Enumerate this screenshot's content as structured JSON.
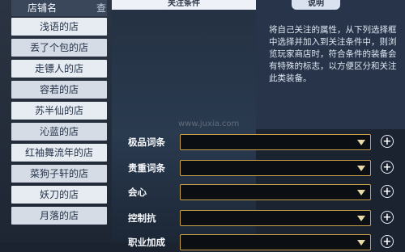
{
  "shop_list": {
    "header": {
      "name_col": "店铺名",
      "second_col": "查"
    },
    "items": [
      {
        "label": "浅语的店"
      },
      {
        "label": "丢了个包的店"
      },
      {
        "label": "走镖人的店"
      },
      {
        "label": "容若的店"
      },
      {
        "label": "苏半仙的店"
      },
      {
        "label": "沁蓝的店"
      },
      {
        "label": "红袖舞流年的店"
      },
      {
        "label": "菜狗子轩的店"
      },
      {
        "label": "妖刀的店"
      },
      {
        "label": "月落的店"
      }
    ]
  },
  "filter_panel": {
    "title": "关注条件",
    "rows": [
      {
        "label": "极品词条",
        "value": ""
      },
      {
        "label": "贵重词条",
        "value": ""
      },
      {
        "label": "会心",
        "value": ""
      },
      {
        "label": "控制抗",
        "value": ""
      },
      {
        "label": "职业加成",
        "value": ""
      }
    ],
    "add_icon": "plus-icon",
    "dropdown_icon": "chevron-down-icon"
  },
  "description": {
    "badge": "说明",
    "text": "将自己关注的属性，从下列选择框中选择并加入到关注条件中，则浏览玩家商店时，符合条件的装备会有特殊的标志，以方便区分和关注此类装备。"
  },
  "watermark": "www.juxia.com",
  "colors": {
    "select_border": "#c9a24a",
    "select_bg": "#0b0e13",
    "list_item_bg": "#e7ecf3"
  }
}
